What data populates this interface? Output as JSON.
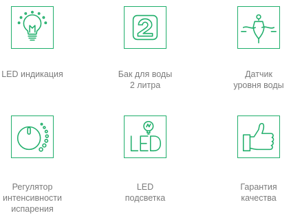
{
  "accent_color": "#1fae6a",
  "features": [
    {
      "icon": "light-bulb-icon",
      "label": "LED индикация"
    },
    {
      "icon": "number-two-icon",
      "label": "Бак для воды\n2 литра"
    },
    {
      "icon": "float-sensor-icon",
      "label": "Датчик\nуровня воды"
    },
    {
      "icon": "dial-knob-icon",
      "label": "Регулятор\nинтенсивности\nиспарения"
    },
    {
      "icon": "led-bulb-icon",
      "label": "LED\nподсветка"
    },
    {
      "icon": "thumbs-up-icon",
      "label": "Гарантия\nкачества"
    }
  ]
}
